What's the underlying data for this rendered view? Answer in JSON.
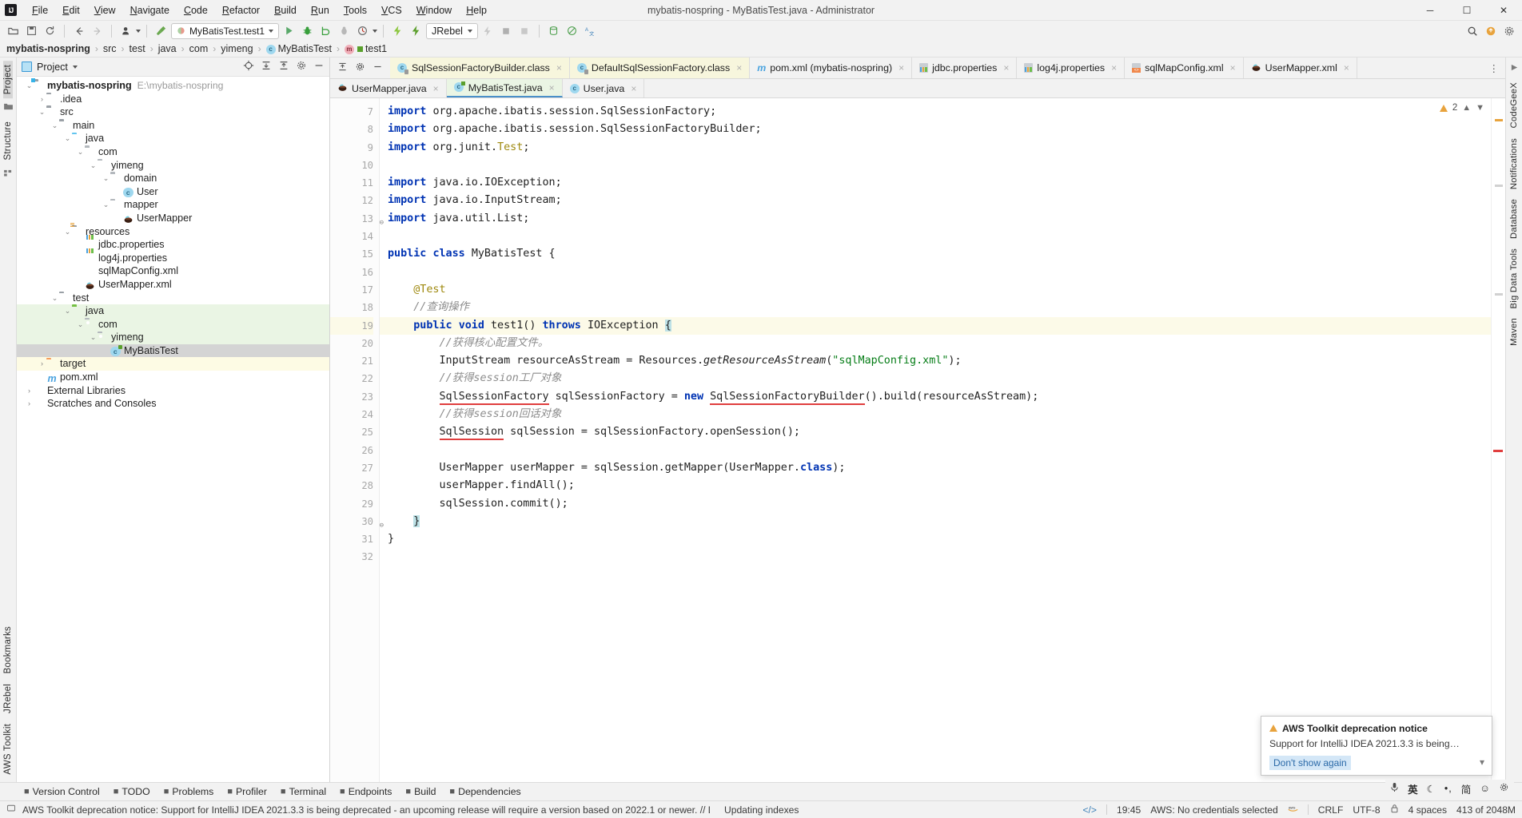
{
  "window": {
    "title": "mybatis-nospring - MyBatisTest.java - Administrator",
    "logo": "IJ",
    "minimize": "─",
    "maximize": "☐",
    "close": "✕"
  },
  "menu": [
    {
      "label": "File"
    },
    {
      "label": "Edit"
    },
    {
      "label": "View"
    },
    {
      "label": "Navigate"
    },
    {
      "label": "Code"
    },
    {
      "label": "Refactor"
    },
    {
      "label": "Build"
    },
    {
      "label": "Run"
    },
    {
      "label": "Tools"
    },
    {
      "label": "VCS"
    },
    {
      "label": "Window"
    },
    {
      "label": "Help"
    }
  ],
  "toolbar": {
    "open_icon": "open-folder-icon",
    "save_icon": "save-icon",
    "sync_icon": "refresh-icon",
    "back_icon": "arrow-left-icon",
    "forward_icon": "arrow-right-icon",
    "profile_icon": "user-profile-icon",
    "build_icon": "hammer-icon",
    "run_config": "MyBatisTest.test1",
    "run_icon": "run-triangle-icon",
    "debug_icon": "debug-bug-icon",
    "coverage_icon": "coverage-icon",
    "profile_run_icon": "profiler-icon",
    "rerun_icon": "rerun-icon",
    "jrebel_label": "JRebel",
    "jrebel_run_icon": "jrebel-run-icon",
    "jrebel_debug_icon": "jrebel-debug-icon",
    "search_icon": "search-icon",
    "plugin_icon": "plugin-update-icon",
    "settings_icon": "gear-icon",
    "stop_icon": "stop-square-icon",
    "db_icon": "database-icon",
    "block_icon": "no-entry-icon",
    "translate_icon": "translate-icon"
  },
  "breadcrumb": {
    "items": [
      {
        "label": "mybatis-nospring",
        "icon": "",
        "bold": true
      },
      {
        "label": "src",
        "icon": ""
      },
      {
        "label": "test",
        "icon": ""
      },
      {
        "label": "java",
        "icon": ""
      },
      {
        "label": "com",
        "icon": ""
      },
      {
        "label": "yimeng",
        "icon": ""
      },
      {
        "label": "MyBatisTest",
        "icon": "class-icon"
      },
      {
        "label": "test1",
        "icon": "method-icon"
      }
    ]
  },
  "left_rail": {
    "project_label": "Project",
    "structure_label": "Structure",
    "bookmarks_label": "Bookmarks",
    "jrebel_label": "JRebel",
    "aws_label": "AWS Toolkit"
  },
  "right_rail": {
    "codegeex_label": "CodeGeeX",
    "notifications_label": "Notifications",
    "database_label": "Database",
    "bigdata_label": "Big Data Tools",
    "maven_label": "Maven"
  },
  "project_pane": {
    "title": "Project",
    "dropdown_icon": "chevron-down-icon",
    "locate_icon": "target-crosshair-icon",
    "expand_icon": "expand-all-icon",
    "collapse_icon": "collapse-all-icon",
    "settings_icon": "gear-icon",
    "hide_icon": "minimize-icon",
    "tree": [
      {
        "label": "mybatis-nospring",
        "path": "E:\\mybatis-nospring",
        "depth": 0,
        "arrow": "down",
        "icon": "module-folder",
        "bold": true
      },
      {
        "label": ".idea",
        "depth": 1,
        "arrow": "right",
        "icon": "folder-gray"
      },
      {
        "label": "src",
        "depth": 1,
        "arrow": "down",
        "icon": "folder-gray"
      },
      {
        "label": "main",
        "depth": 2,
        "arrow": "down",
        "icon": "folder-gray"
      },
      {
        "label": "java",
        "depth": 3,
        "arrow": "down",
        "icon": "folder-blue"
      },
      {
        "label": "com",
        "depth": 4,
        "arrow": "down",
        "icon": "package"
      },
      {
        "label": "yimeng",
        "depth": 5,
        "arrow": "down",
        "icon": "package"
      },
      {
        "label": "domain",
        "depth": 6,
        "arrow": "down",
        "icon": "package"
      },
      {
        "label": "User",
        "depth": 7,
        "arrow": "none",
        "icon": "class"
      },
      {
        "label": "mapper",
        "depth": 6,
        "arrow": "down",
        "icon": "package"
      },
      {
        "label": "UserMapper",
        "depth": 7,
        "arrow": "none",
        "icon": "mybatis"
      },
      {
        "label": "resources",
        "depth": 3,
        "arrow": "down",
        "icon": "folder-resources"
      },
      {
        "label": "jdbc.properties",
        "depth": 4,
        "arrow": "none",
        "icon": "properties"
      },
      {
        "label": "log4j.properties",
        "depth": 4,
        "arrow": "none",
        "icon": "properties"
      },
      {
        "label": "sqlMapConfig.xml",
        "depth": 4,
        "arrow": "none",
        "icon": "xml"
      },
      {
        "label": "UserMapper.xml",
        "depth": 4,
        "arrow": "none",
        "icon": "mybatis"
      },
      {
        "label": "test",
        "depth": 2,
        "arrow": "down",
        "icon": "folder-gray"
      },
      {
        "label": "java",
        "depth": 3,
        "arrow": "down",
        "icon": "folder-green",
        "row": "green"
      },
      {
        "label": "com",
        "depth": 4,
        "arrow": "down",
        "icon": "package",
        "row": "green"
      },
      {
        "label": "yimeng",
        "depth": 5,
        "arrow": "down",
        "icon": "package",
        "row": "green"
      },
      {
        "label": "MyBatisTest",
        "depth": 6,
        "arrow": "none",
        "icon": "class-test",
        "row": "sel"
      },
      {
        "label": "target",
        "depth": 1,
        "arrow": "right",
        "icon": "folder-orange",
        "row": "yellow"
      },
      {
        "label": "pom.xml",
        "depth": 1,
        "arrow": "none",
        "icon": "maven"
      },
      {
        "label": "External Libraries",
        "depth": 0,
        "arrow": "right",
        "icon": "libraries"
      },
      {
        "label": "Scratches and Consoles",
        "depth": 0,
        "arrow": "right",
        "icon": "scratches"
      }
    ]
  },
  "editor": {
    "tools": {
      "collapse_icon": "collapse-all-icon",
      "settings_icon": "gear-icon",
      "hide_icon": "hide-icon",
      "overflow_icon": "more-tabs-icon"
    },
    "tabs_row1": [
      {
        "label": "SqlSessionFactoryBuilder.class",
        "icon": "class-locked-icon",
        "style": "cls"
      },
      {
        "label": "DefaultSqlSessionFactory.class",
        "icon": "class-locked-icon",
        "style": "cls"
      },
      {
        "label": "pom.xml (mybatis-nospring)",
        "icon": "maven-icon",
        "style": "plain"
      },
      {
        "label": "jdbc.properties",
        "icon": "properties-icon",
        "style": "plain"
      },
      {
        "label": "log4j.properties",
        "icon": "properties-icon",
        "style": "plain"
      },
      {
        "label": "sqlMapConfig.xml",
        "icon": "xml-icon",
        "style": "plain"
      },
      {
        "label": "UserMapper.xml",
        "icon": "mybatis-icon",
        "style": "plain"
      }
    ],
    "tabs_row2": [
      {
        "label": "UserMapper.java",
        "icon": "mybatis-icon",
        "style": "plain"
      },
      {
        "label": "MyBatisTest.java",
        "icon": "class-test-icon",
        "style": "active"
      },
      {
        "label": "User.java",
        "icon": "class-icon",
        "style": "plain"
      }
    ],
    "inspection": {
      "warning_count": "2",
      "up_icon": "chevron-up-icon",
      "down_icon": "chevron-down-icon"
    },
    "first_line_number": 7,
    "lines": [
      {
        "n": 7,
        "segs": [
          {
            "t": "import ",
            "c": "kw"
          },
          {
            "t": "org.apache.ibatis.session.SqlSessionFactory;"
          }
        ]
      },
      {
        "n": 8,
        "segs": [
          {
            "t": "import ",
            "c": "kw"
          },
          {
            "t": "org.apache.ibatis.session.SqlSessionFactoryBuilder;"
          }
        ]
      },
      {
        "n": 9,
        "segs": [
          {
            "t": "import ",
            "c": "kw"
          },
          {
            "t": "org.junit."
          },
          {
            "t": "Test",
            "c": "an"
          },
          {
            "t": ";"
          }
        ]
      },
      {
        "n": 10,
        "segs": []
      },
      {
        "n": 11,
        "segs": [
          {
            "t": "import ",
            "c": "kw"
          },
          {
            "t": "java.io.IOException;"
          }
        ]
      },
      {
        "n": 12,
        "segs": [
          {
            "t": "import ",
            "c": "kw"
          },
          {
            "t": "java.io.InputStream;"
          }
        ]
      },
      {
        "n": 13,
        "segs": [
          {
            "t": "import ",
            "c": "kw"
          },
          {
            "t": "java.util.List;"
          }
        ],
        "fold": true
      },
      {
        "n": 14,
        "segs": []
      },
      {
        "n": 15,
        "segs": [
          {
            "t": "public ",
            "c": "kw"
          },
          {
            "t": "class ",
            "c": "kw"
          },
          {
            "t": "MyBatisTest {"
          }
        ]
      },
      {
        "n": 16,
        "segs": []
      },
      {
        "n": 17,
        "segs": [
          {
            "t": "    "
          },
          {
            "t": "@Test",
            "c": "an"
          }
        ]
      },
      {
        "n": 18,
        "segs": [
          {
            "t": "    "
          },
          {
            "t": "//查询操作",
            "c": "cm"
          }
        ]
      },
      {
        "n": 19,
        "segs": [
          {
            "t": "    "
          },
          {
            "t": "public ",
            "c": "kw"
          },
          {
            "t": "void ",
            "c": "kw"
          },
          {
            "t": "test1() "
          },
          {
            "t": "throws ",
            "c": "kw"
          },
          {
            "t": "IOException "
          },
          {
            "t": "{",
            "c": "caret"
          }
        ],
        "cur": true,
        "fold": true
      },
      {
        "n": 20,
        "segs": [
          {
            "t": "        "
          },
          {
            "t": "//获得核心配置文件。",
            "c": "cm"
          }
        ]
      },
      {
        "n": 21,
        "segs": [
          {
            "t": "        InputStream resourceAsStream = Resources."
          },
          {
            "t": "getResourceAsStream",
            "c": "it"
          },
          {
            "t": "("
          },
          {
            "t": "\"sqlMapConfig.xml\"",
            "c": "st"
          },
          {
            "t": ");"
          }
        ]
      },
      {
        "n": 22,
        "segs": [
          {
            "t": "        "
          },
          {
            "t": "//获得session工厂对象",
            "c": "cm"
          }
        ]
      },
      {
        "n": 23,
        "segs": [
          {
            "t": "        "
          },
          {
            "t": "SqlSessionFactory",
            "c": "ul"
          },
          {
            "t": " sqlSessionFactory = "
          },
          {
            "t": "new ",
            "c": "kw"
          },
          {
            "t": "SqlSessionFactoryBuilder",
            "c": "ul"
          },
          {
            "t": "().build(resourceAsStream);"
          }
        ]
      },
      {
        "n": 24,
        "segs": [
          {
            "t": "        "
          },
          {
            "t": "//获得session回话对象",
            "c": "cm"
          }
        ]
      },
      {
        "n": 25,
        "segs": [
          {
            "t": "        "
          },
          {
            "t": "SqlSession",
            "c": "ul"
          },
          {
            "t": " sqlSession = sqlSessionFactory.openSession();"
          }
        ]
      },
      {
        "n": 26,
        "segs": []
      },
      {
        "n": 27,
        "segs": [
          {
            "t": "        UserMapper userMapper = sqlSession.getMapper(UserMapper."
          },
          {
            "t": "class",
            "c": "kw"
          },
          {
            "t": ");"
          }
        ]
      },
      {
        "n": 28,
        "segs": [
          {
            "t": "        userMapper.findAll();"
          }
        ]
      },
      {
        "n": 29,
        "segs": [
          {
            "t": "        sqlSession.commit();"
          }
        ]
      },
      {
        "n": 30,
        "segs": [
          {
            "t": "    "
          },
          {
            "t": "}",
            "c": "caret"
          }
        ],
        "fold": true
      },
      {
        "n": 31,
        "segs": [
          {
            "t": "}"
          }
        ]
      },
      {
        "n": 32,
        "segs": []
      }
    ]
  },
  "notification": {
    "icon": "warning-triangle-icon",
    "title": "AWS Toolkit deprecation notice",
    "body": "Support for IntelliJ IDEA 2021.3.3 is being…",
    "action": "Don't show again",
    "expand_icon": "chevron-down-icon"
  },
  "toolwindows": [
    {
      "label": "Version Control",
      "icon": "branch-icon"
    },
    {
      "label": "TODO",
      "icon": "list-icon"
    },
    {
      "label": "Problems",
      "icon": "error-circle-icon"
    },
    {
      "label": "Profiler",
      "icon": "profiler-icon"
    },
    {
      "label": "Terminal",
      "icon": "terminal-icon"
    },
    {
      "label": "Endpoints",
      "icon": "endpoints-icon"
    },
    {
      "label": "Build",
      "icon": "hammer-icon"
    },
    {
      "label": "Dependencies",
      "icon": "layers-icon"
    }
  ],
  "statusbar": {
    "message_icon": "balloon-icon",
    "message": "AWS Toolkit deprecation notice: Support for IntelliJ IDEA 2021.3.3 is being deprecated - an upcoming release will require a version based on 2022.1 or newer. // Don't show ag…",
    "indexing": "Updating indexes",
    "code_icon": "code-brackets-icon",
    "time": "19:45",
    "aws": "AWS: No credentials selected",
    "aws_icon": "aws-icon",
    "line_sep": "CRLF",
    "encoding": "UTF-8",
    "lock_icon": "lock-icon",
    "indent": "4 spaces",
    "memory": "413 of 2048M"
  },
  "ime": {
    "mic_icon": "microphone-icon",
    "lang": "英",
    "moon_icon": "moon-icon",
    "dots_icon": "dots-icon",
    "simplified": "简",
    "smiley_icon": "smiley-icon",
    "gear_icon": "gear-icon"
  },
  "colors": {
    "accent": "#4a90c9",
    "selection": "#d4d4d4",
    "test_source": "#eaf5e4",
    "target_yellow": "#fdfbe4",
    "error_red": "#e03e3e",
    "keyword_blue": "#0033b3",
    "string_green": "#067d17",
    "comment_gray": "#8c8c8c",
    "annotation": "#9e880d"
  }
}
